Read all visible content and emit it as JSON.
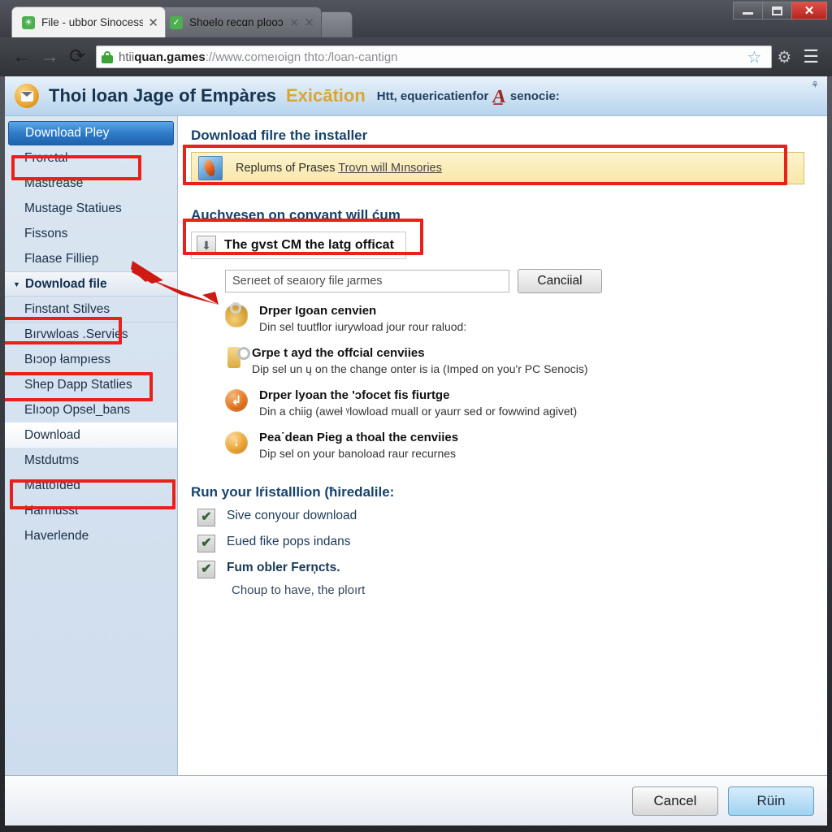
{
  "window": {
    "minimize_label": "minimize",
    "maximize_label": "maximize",
    "close_label": "✕"
  },
  "tabs": [
    {
      "title": "File - ubbor Sinocess",
      "close": "✕",
      "favicon": "page-icon",
      "active": true
    },
    {
      "title": "Shoelo recɑn plooɔ",
      "close": "✕",
      "close2": "✕",
      "favicon": "check-icon",
      "active": false
    }
  ],
  "navbar": {
    "back": "←",
    "forward": "→",
    "reload": "⟳",
    "url_scheme": "htii",
    "url_host": "quan.games",
    "url_rest": "://www.comeıoign thto:/loan-cantign",
    "star": "☆",
    "gear": "⚙",
    "menu": "☰"
  },
  "site_header": {
    "title": "Thoi loan Jage of Empàres",
    "accent": "Exicātion",
    "tagline_before": "Htt, equericatienfor",
    "tagline_mark": "A̲",
    "tagline_after": "senocie:",
    "corner_icon": "⚘"
  },
  "sidebar": {
    "items": [
      {
        "label": "Download Pley",
        "type": "selected",
        "boxed": true
      },
      {
        "label": "Froretal",
        "type": "normal"
      },
      {
        "label": "Mastrease",
        "type": "normal"
      },
      {
        "label": "Mustage Statiues",
        "type": "normal"
      },
      {
        "label": "Fissons",
        "type": "normal"
      },
      {
        "label": "Flaase Filliep",
        "type": "normal"
      },
      {
        "label": "Download file",
        "type": "group",
        "triangle": "▼",
        "boxed": true
      },
      {
        "label": "Finstant Stilves",
        "type": "normal"
      },
      {
        "label": "Bırvwloas .Servies",
        "type": "normal",
        "boxed": true,
        "sep": true
      },
      {
        "label": "Bıɔop łampıess",
        "type": "normal"
      },
      {
        "label": "Shep Dapp Statlies",
        "type": "normal"
      },
      {
        "label": "Elıɔop Opsel_bans",
        "type": "normal"
      },
      {
        "label": "Download",
        "type": "white",
        "boxed": true
      },
      {
        "label": "Mstdutms",
        "type": "normal"
      },
      {
        "label": "Mattoıded",
        "type": "normal"
      },
      {
        "label": "Harmusst",
        "type": "normal"
      },
      {
        "label": "Haverlende",
        "type": "normal"
      }
    ]
  },
  "main": {
    "heading_1": "Download filre the installer",
    "notice": {
      "icon": "installer-file-icon",
      "text": "Replums of Prases",
      "link": "Trovn will Mınsories"
    },
    "heading_2": "Auchvesen on convant will ćum",
    "download_callout": {
      "icon": "download-arrow-icon",
      "label": "The gvst CM the latg officat"
    },
    "file_field_value": "Serıeet of seaıory file ȷarmes",
    "cancel_small_label": "Canciial",
    "options": [
      {
        "icon": "keys-icon",
        "title": "Drper Igoan cenvien",
        "desc": "Din sel tuutflor iurywload jour rour raluod:"
      },
      {
        "icon": "key-lock-icon",
        "title": "Grpe t ayd the offcial cenviies",
        "desc": "Dip sel un ų on the change onter is ia (Imped on you'r PC Senocis)"
      },
      {
        "icon": "orange-arrow-icon",
        "glyph": "↲",
        "title": "Drper lyoan the 'ɔfocet fis fiurtge",
        "desc": "Din a chiig (aweł ᵞlowload muall or yaurr sed or fowwind agivet)"
      },
      {
        "icon": "amber-down-arrow-icon",
        "glyph": "↓",
        "title": "Pea˙dean Pieɡ a thoal the cenviies",
        "desc": "Dip sel on your banoload raur recurnes"
      }
    ],
    "heading_3": "Run your  lŕistalllion (ħiredalile:",
    "checkboxes": [
      {
        "check": "✔",
        "label": "Sive conyour download",
        "bold": false
      },
      {
        "check": "✔",
        "label": "Eued fike pops indans",
        "bold": false
      },
      {
        "check": "✔",
        "label": "Fum obler Ferņcts.",
        "bold": true
      }
    ],
    "checkbox_subnote": "Choup to have, the ploırt"
  },
  "footer": {
    "cancel_label": "Cancel",
    "run_label": "Rüin"
  },
  "colors": {
    "accent_blue": "#2f7bc8",
    "annotation_red": "#e8211a",
    "notice_yellow": "#f8e7a9",
    "header_gold": "#d9a634"
  }
}
